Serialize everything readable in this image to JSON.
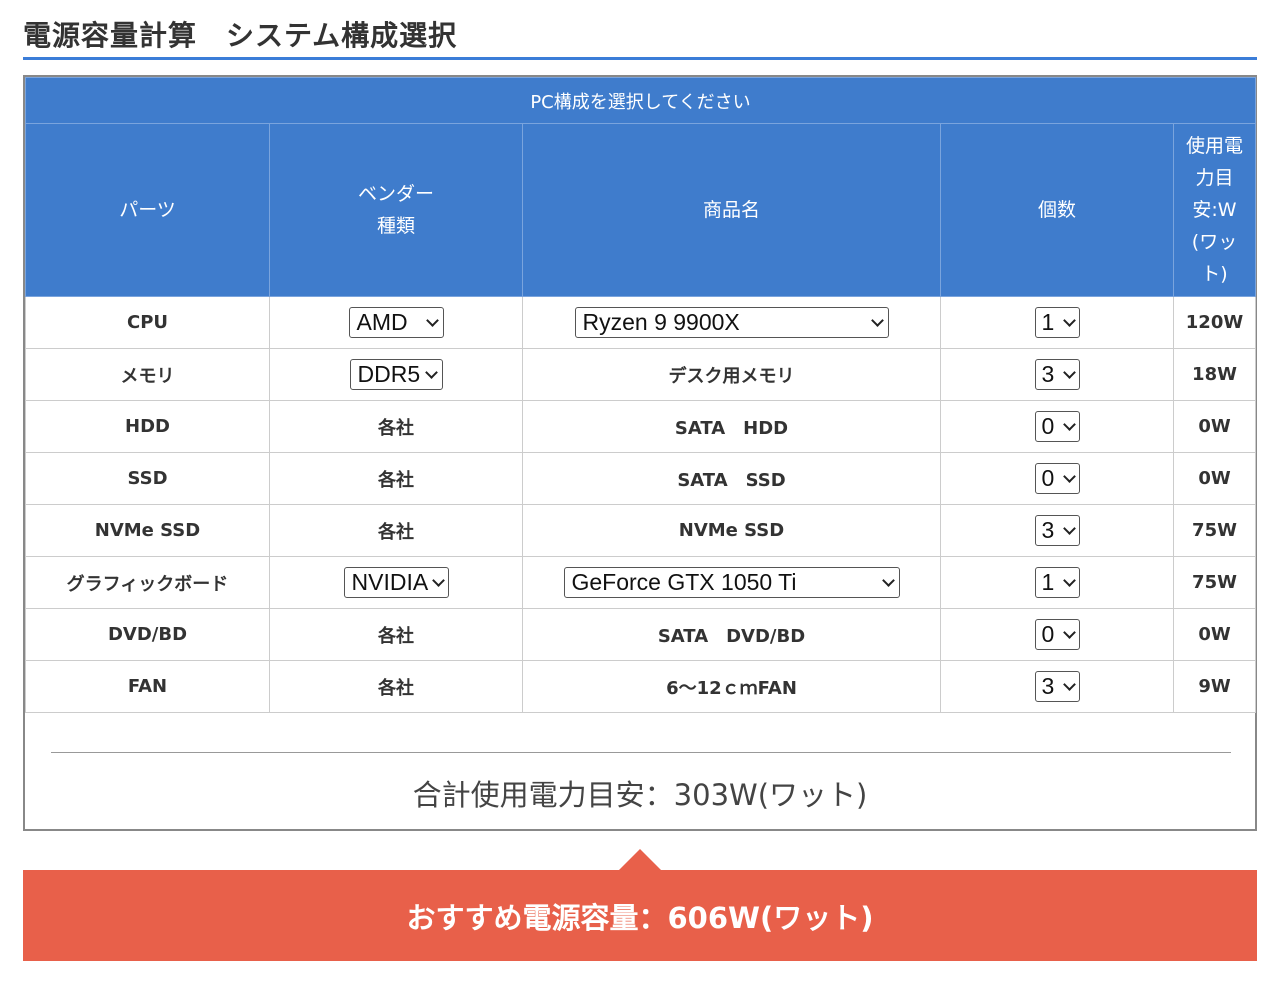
{
  "page": {
    "title": "電源容量計算　システム構成選択"
  },
  "table": {
    "caption": "PC構成を選択してください",
    "headers": {
      "part": "パーツ",
      "vendor_line1": "ベンダー",
      "vendor_line2": "種類",
      "product": "商品名",
      "quantity": "個数",
      "watt": "使用電力目安:W(ワット)"
    },
    "rows": [
      {
        "part": "CPU",
        "vendor": "AMD",
        "vendor_select": true,
        "product": "Ryzen 9 9900X",
        "product_select": true,
        "quantity": "1",
        "watt": "120W"
      },
      {
        "part": "メモリ",
        "vendor": "DDR5",
        "vendor_select": true,
        "product": "デスク用メモリ",
        "product_select": false,
        "quantity": "3",
        "watt": "18W"
      },
      {
        "part": "HDD",
        "vendor": "各社",
        "vendor_select": false,
        "product": "SATA　HDD",
        "product_select": false,
        "quantity": "0",
        "watt": "0W"
      },
      {
        "part": "SSD",
        "vendor": "各社",
        "vendor_select": false,
        "product": "SATA　SSD",
        "product_select": false,
        "quantity": "0",
        "watt": "0W"
      },
      {
        "part": "NVMe SSD",
        "vendor": "各社",
        "vendor_select": false,
        "product": "NVMe SSD",
        "product_select": false,
        "quantity": "3",
        "watt": "75W"
      },
      {
        "part": "グラフィックボード",
        "vendor": "NVIDIA",
        "vendor_select": true,
        "product": "GeForce GTX 1050 Ti",
        "product_select": true,
        "quantity": "1",
        "watt": "75W"
      },
      {
        "part": "DVD/BD",
        "vendor": "各社",
        "vendor_select": false,
        "product": "SATA　DVD/BD",
        "product_select": false,
        "quantity": "0",
        "watt": "0W"
      },
      {
        "part": "FAN",
        "vendor": "各社",
        "vendor_select": false,
        "product": "6～12ｃｍFAN",
        "product_select": false,
        "quantity": "3",
        "watt": "9W"
      }
    ]
  },
  "total": {
    "text": "合計使用電力目安：303W(ワット)"
  },
  "recommendation": {
    "text": "おすすめ電源容量：606W(ワット)"
  },
  "colors": {
    "header_blue": "#3f7ccc",
    "title_rule_blue": "#3b7dd8",
    "banner_red": "#e8604a"
  }
}
